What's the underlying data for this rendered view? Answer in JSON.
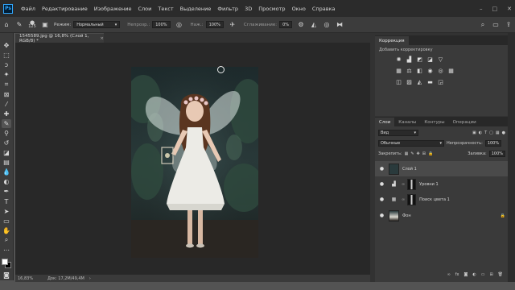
{
  "menu": {
    "app_icon": "Ps",
    "items": [
      "Файл",
      "Редактирование",
      "Изображение",
      "Слои",
      "Текст",
      "Выделение",
      "Фильтр",
      "3D",
      "Просмотр",
      "Окно",
      "Справка"
    ]
  },
  "window_controls": [
    "–",
    "□",
    "✕"
  ],
  "options": {
    "brush_size": "125",
    "mode_label": "Режим:",
    "mode_value": "Нормальный",
    "opacity_label": "Непрозр.:",
    "opacity_value": "100%",
    "flow_label": "Наж.:",
    "flow_value": "100%",
    "smooth_label": "Сглаживание:",
    "smooth_value": "0%"
  },
  "document": {
    "tab_label": "1545589.jpg @ 16,8% (Слой 1, RGB/8) *",
    "close": "×",
    "zoom": "16,83%",
    "doc_info": "Док: 17,2M/49,4M"
  },
  "correction": {
    "tab": "Коррекция",
    "subtitle": "Добавить корректировку"
  },
  "layers_panel": {
    "tabs": [
      "Слои",
      "Каналы",
      "Контуры",
      "Операции"
    ],
    "kind_value": "Вид",
    "blend_value": "Обычные",
    "opacity_label": "Непрозрачность:",
    "opacity_value": "100%",
    "lock_label": "Закрепить:",
    "fill_label": "Заливка:",
    "fill_value": "100%",
    "layers": [
      {
        "name": "Слой 1"
      },
      {
        "name": "Уровни 1"
      },
      {
        "name": "Поиск цвета 1"
      },
      {
        "name": "Фон"
      }
    ]
  },
  "colors": {
    "menubar_bg": "#2b2b2b",
    "panel_bg": "#3a3a3a",
    "canvas_bg": "#282828",
    "accent": "#31a8ff"
  }
}
